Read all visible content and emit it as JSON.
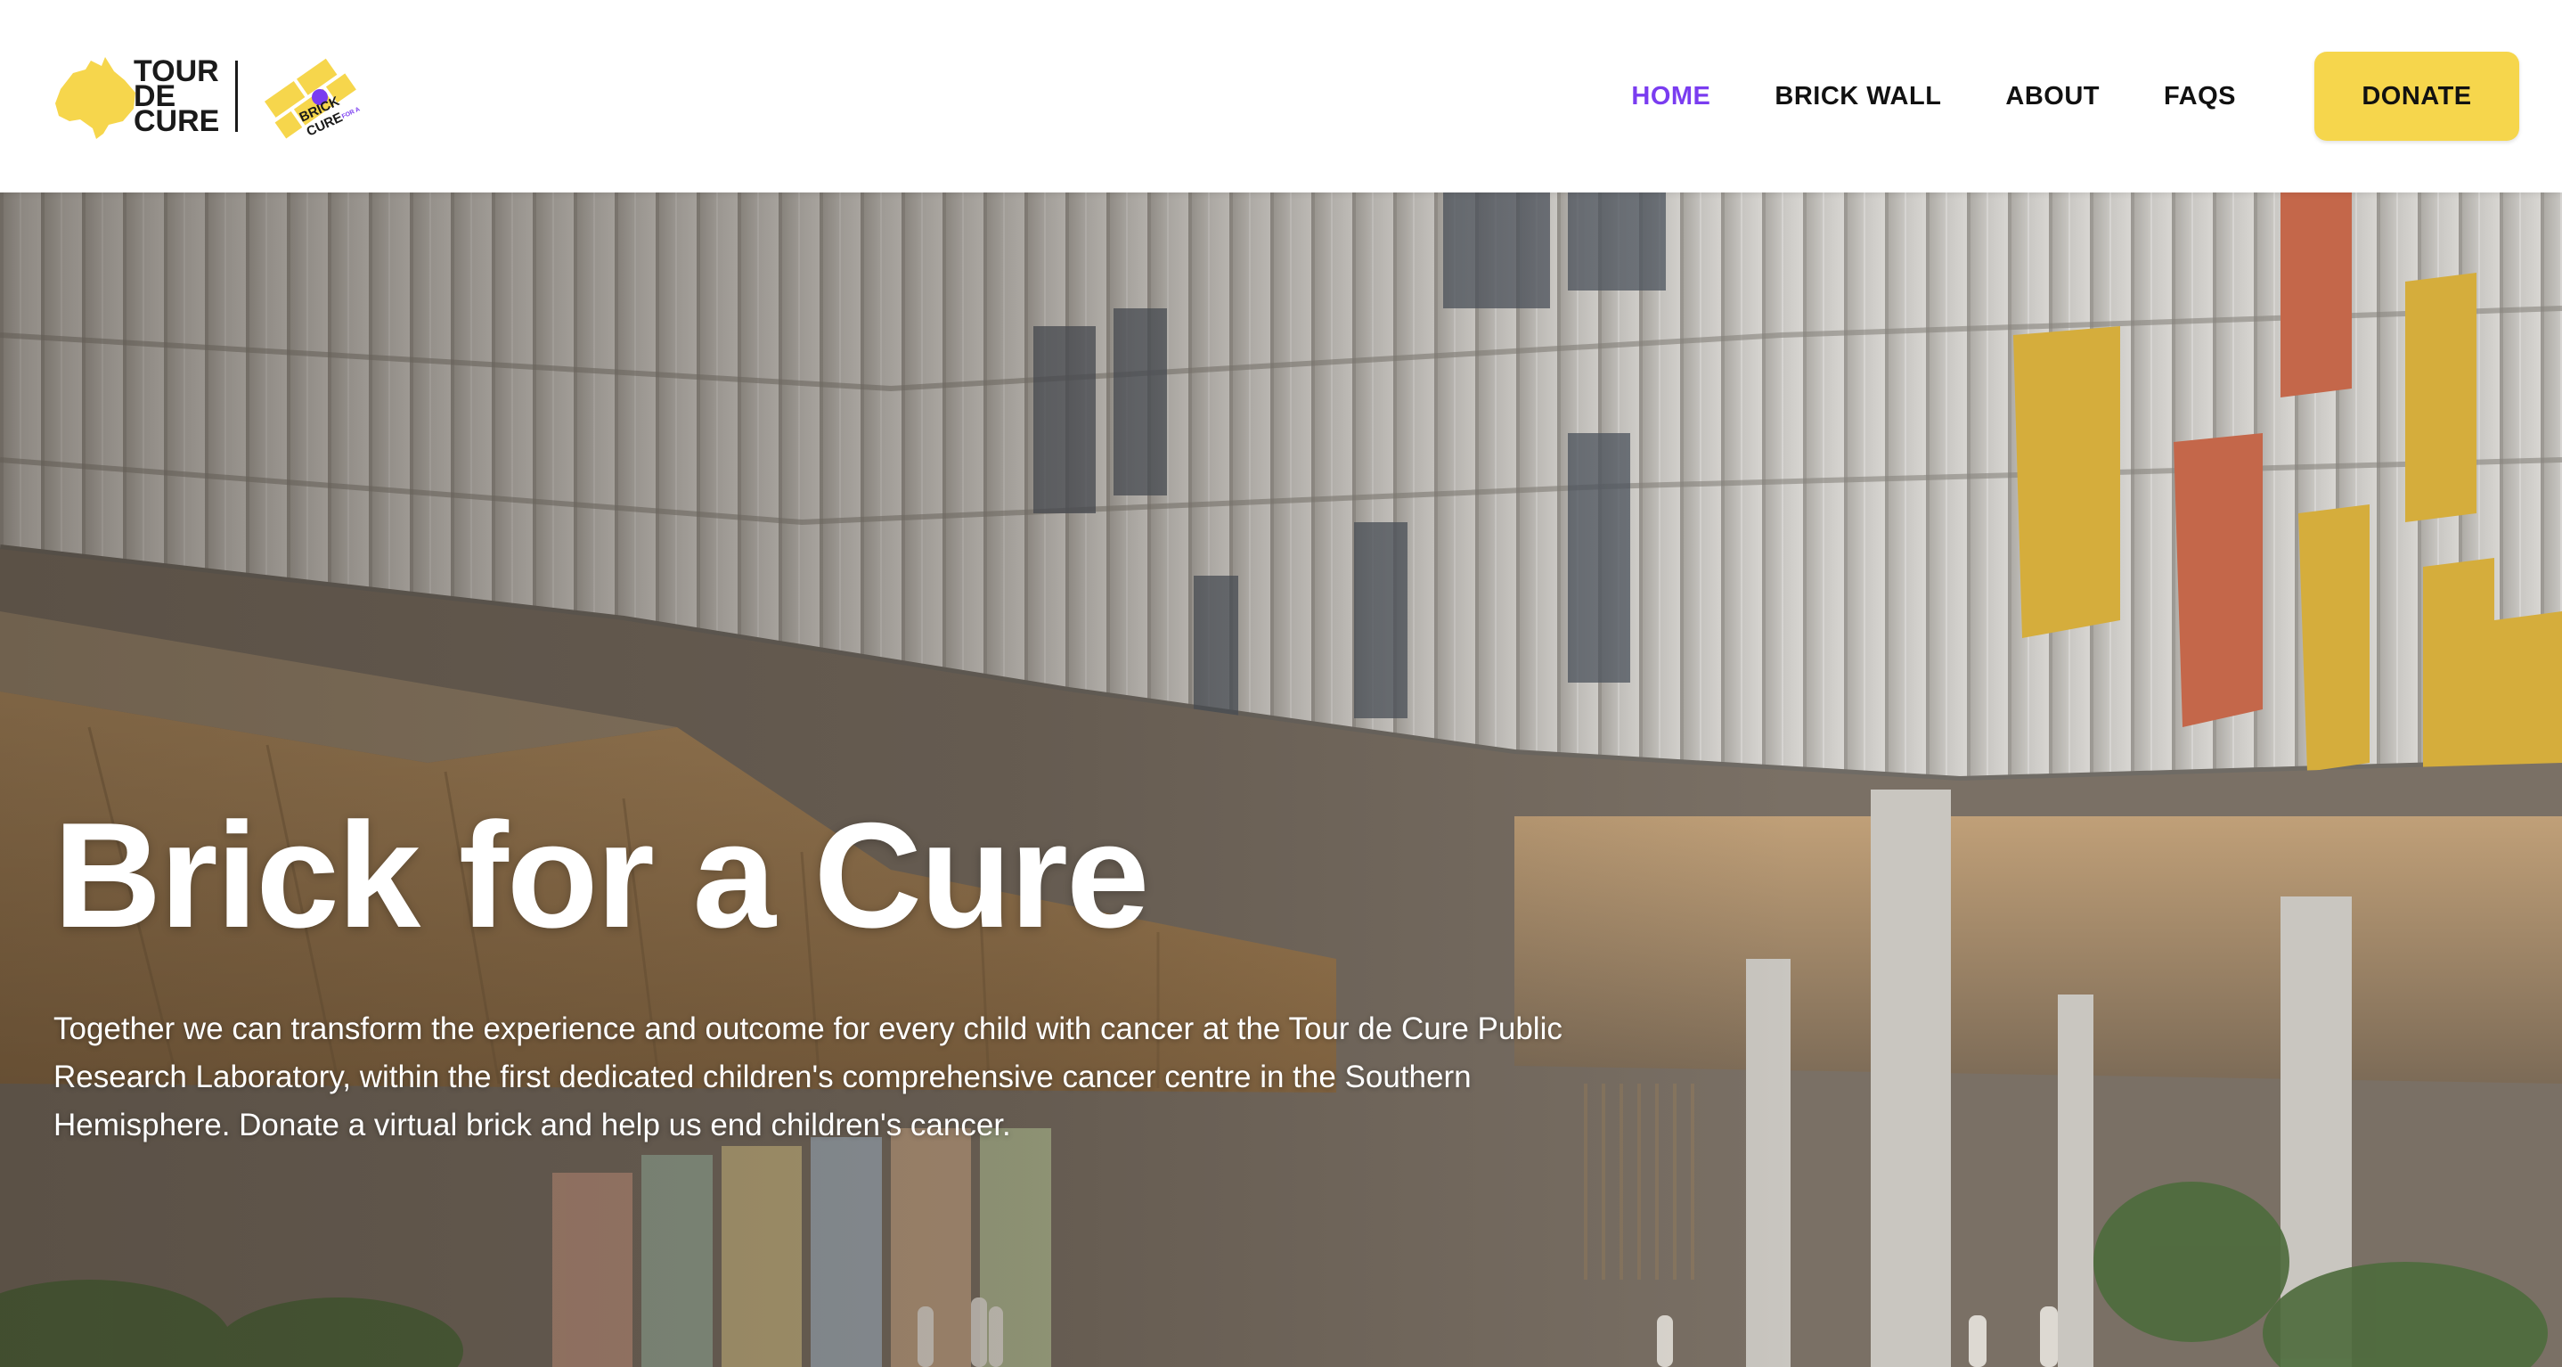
{
  "brand": {
    "tdc_logo_lines": [
      "TOUR",
      "DE",
      "CURE"
    ],
    "bfac_logo_lines": [
      "BRICK",
      "CURE"
    ],
    "bfac_logo_small": "FOR A",
    "brand_yellow": "#f6d64c",
    "accent_purple": "#7a3cf0"
  },
  "nav": {
    "items": [
      {
        "label": "HOME",
        "active": true
      },
      {
        "label": "BRICK WALL",
        "active": false
      },
      {
        "label": "ABOUT",
        "active": false
      },
      {
        "label": "FAQS",
        "active": false
      }
    ],
    "donate_label": "DONATE"
  },
  "hero": {
    "title": "Brick for a Cure",
    "description": "Together we can transform the experience and outcome for every child with cancer at the Tour de Cure Public Research Laboratory, within the first dedicated children's comprehensive cancer centre in the Southern Hemisphere. Donate a virtual brick and help us end children's cancer."
  }
}
